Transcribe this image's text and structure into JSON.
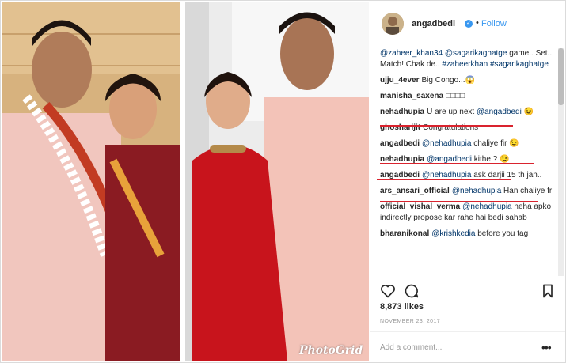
{
  "post": {
    "username": "angadbedi",
    "follow_label": "Follow",
    "dot": "•",
    "watermark": "PhotoGrid",
    "likes": "8,873 likes",
    "date": "NOVEMBER 23, 2017",
    "add_comment_placeholder": "Add a comment...",
    "more_label": "•••",
    "caption": {
      "mention1": "@zaheer_khan34",
      "mention2": "@sagarikaghatge",
      "text": "game.. Set.. Match! Chak de..",
      "tag1": "#zaheerkhan",
      "tag2": "#sagarikaghatge"
    }
  },
  "comments": [
    {
      "user": "ujju_4ever",
      "text": "Big Congo...😱"
    },
    {
      "user": "manisha_saxena",
      "text": "□□□□"
    },
    {
      "user": "nehadhupia",
      "text": "U are up next",
      "mention": "@angadbedi",
      "tail": "😉"
    },
    {
      "user": "ghosharijit",
      "text": "Congratulations"
    },
    {
      "user": "angadbedi",
      "mention": "@nehadhupia",
      "text": "chaliye fir 😉"
    },
    {
      "user": "nehadhupia",
      "mention": "@angadbedi",
      "text": "kithe ? 😉"
    },
    {
      "user": "angadbedi",
      "mention": "@nehadhupia",
      "text": "ask darjii 15 th jan.."
    },
    {
      "user": "ars_ansari_official",
      "mention": "@nehadhupia",
      "text": "Han chaliye fr"
    },
    {
      "user": "official_vishal_verma",
      "mention": "@nehadhupia",
      "text": "neha apko indirectly propose kar rahe hai bedi sahab"
    },
    {
      "user": "bharanikonal",
      "mention": "@krishkedia",
      "text": "before you tag"
    }
  ],
  "colors": {
    "accent": "#3897f0",
    "underline": "#d9232e",
    "mention": "#003569"
  }
}
